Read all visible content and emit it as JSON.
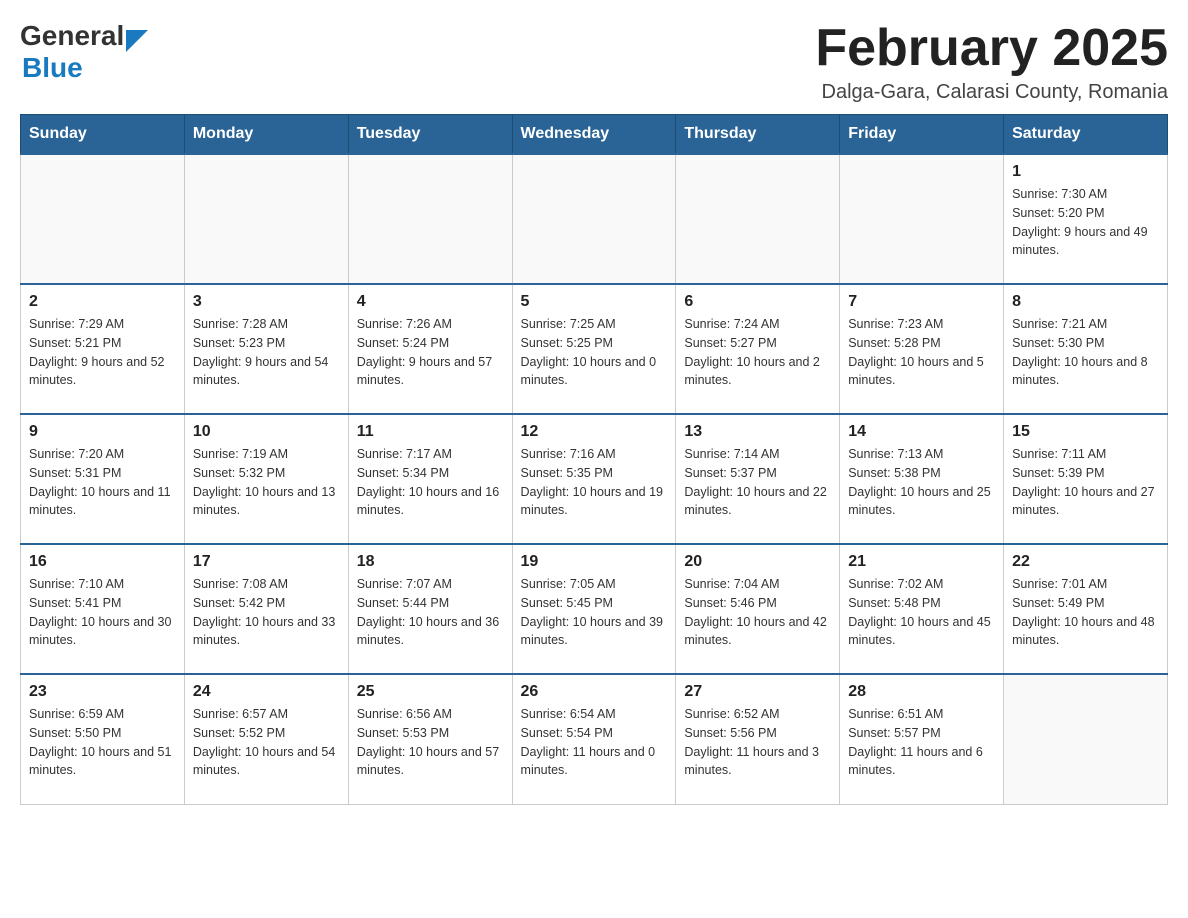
{
  "header": {
    "logo_general": "General",
    "logo_blue": "Blue",
    "month_title": "February 2025",
    "location": "Dalga-Gara, Calarasi County, Romania"
  },
  "weekdays": [
    "Sunday",
    "Monday",
    "Tuesday",
    "Wednesday",
    "Thursday",
    "Friday",
    "Saturday"
  ],
  "weeks": [
    [
      {
        "day": "",
        "info": ""
      },
      {
        "day": "",
        "info": ""
      },
      {
        "day": "",
        "info": ""
      },
      {
        "day": "",
        "info": ""
      },
      {
        "day": "",
        "info": ""
      },
      {
        "day": "",
        "info": ""
      },
      {
        "day": "1",
        "info": "Sunrise: 7:30 AM\nSunset: 5:20 PM\nDaylight: 9 hours and 49 minutes."
      }
    ],
    [
      {
        "day": "2",
        "info": "Sunrise: 7:29 AM\nSunset: 5:21 PM\nDaylight: 9 hours and 52 minutes."
      },
      {
        "day": "3",
        "info": "Sunrise: 7:28 AM\nSunset: 5:23 PM\nDaylight: 9 hours and 54 minutes."
      },
      {
        "day": "4",
        "info": "Sunrise: 7:26 AM\nSunset: 5:24 PM\nDaylight: 9 hours and 57 minutes."
      },
      {
        "day": "5",
        "info": "Sunrise: 7:25 AM\nSunset: 5:25 PM\nDaylight: 10 hours and 0 minutes."
      },
      {
        "day": "6",
        "info": "Sunrise: 7:24 AM\nSunset: 5:27 PM\nDaylight: 10 hours and 2 minutes."
      },
      {
        "day": "7",
        "info": "Sunrise: 7:23 AM\nSunset: 5:28 PM\nDaylight: 10 hours and 5 minutes."
      },
      {
        "day": "8",
        "info": "Sunrise: 7:21 AM\nSunset: 5:30 PM\nDaylight: 10 hours and 8 minutes."
      }
    ],
    [
      {
        "day": "9",
        "info": "Sunrise: 7:20 AM\nSunset: 5:31 PM\nDaylight: 10 hours and 11 minutes."
      },
      {
        "day": "10",
        "info": "Sunrise: 7:19 AM\nSunset: 5:32 PM\nDaylight: 10 hours and 13 minutes."
      },
      {
        "day": "11",
        "info": "Sunrise: 7:17 AM\nSunset: 5:34 PM\nDaylight: 10 hours and 16 minutes."
      },
      {
        "day": "12",
        "info": "Sunrise: 7:16 AM\nSunset: 5:35 PM\nDaylight: 10 hours and 19 minutes."
      },
      {
        "day": "13",
        "info": "Sunrise: 7:14 AM\nSunset: 5:37 PM\nDaylight: 10 hours and 22 minutes."
      },
      {
        "day": "14",
        "info": "Sunrise: 7:13 AM\nSunset: 5:38 PM\nDaylight: 10 hours and 25 minutes."
      },
      {
        "day": "15",
        "info": "Sunrise: 7:11 AM\nSunset: 5:39 PM\nDaylight: 10 hours and 27 minutes."
      }
    ],
    [
      {
        "day": "16",
        "info": "Sunrise: 7:10 AM\nSunset: 5:41 PM\nDaylight: 10 hours and 30 minutes."
      },
      {
        "day": "17",
        "info": "Sunrise: 7:08 AM\nSunset: 5:42 PM\nDaylight: 10 hours and 33 minutes."
      },
      {
        "day": "18",
        "info": "Sunrise: 7:07 AM\nSunset: 5:44 PM\nDaylight: 10 hours and 36 minutes."
      },
      {
        "day": "19",
        "info": "Sunrise: 7:05 AM\nSunset: 5:45 PM\nDaylight: 10 hours and 39 minutes."
      },
      {
        "day": "20",
        "info": "Sunrise: 7:04 AM\nSunset: 5:46 PM\nDaylight: 10 hours and 42 minutes."
      },
      {
        "day": "21",
        "info": "Sunrise: 7:02 AM\nSunset: 5:48 PM\nDaylight: 10 hours and 45 minutes."
      },
      {
        "day": "22",
        "info": "Sunrise: 7:01 AM\nSunset: 5:49 PM\nDaylight: 10 hours and 48 minutes."
      }
    ],
    [
      {
        "day": "23",
        "info": "Sunrise: 6:59 AM\nSunset: 5:50 PM\nDaylight: 10 hours and 51 minutes."
      },
      {
        "day": "24",
        "info": "Sunrise: 6:57 AM\nSunset: 5:52 PM\nDaylight: 10 hours and 54 minutes."
      },
      {
        "day": "25",
        "info": "Sunrise: 6:56 AM\nSunset: 5:53 PM\nDaylight: 10 hours and 57 minutes."
      },
      {
        "day": "26",
        "info": "Sunrise: 6:54 AM\nSunset: 5:54 PM\nDaylight: 11 hours and 0 minutes."
      },
      {
        "day": "27",
        "info": "Sunrise: 6:52 AM\nSunset: 5:56 PM\nDaylight: 11 hours and 3 minutes."
      },
      {
        "day": "28",
        "info": "Sunrise: 6:51 AM\nSunset: 5:57 PM\nDaylight: 11 hours and 6 minutes."
      },
      {
        "day": "",
        "info": ""
      }
    ]
  ]
}
